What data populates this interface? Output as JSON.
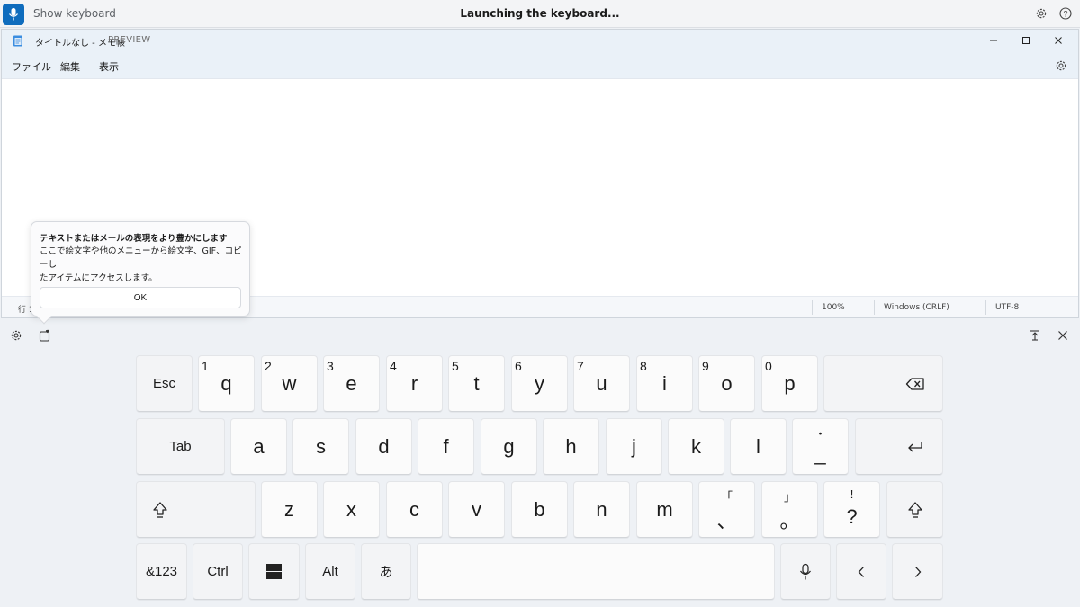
{
  "voice_bar": {
    "hint": "Show keyboard",
    "status": "Launching the keyboard...",
    "settings_icon": "gear-icon",
    "help_icon": "question-icon"
  },
  "notepad": {
    "title": "タイトルなし - メモ帳",
    "preview_badge": "PREVIEW",
    "menu": [
      "ファイル",
      "編集",
      "表示"
    ],
    "status": {
      "line": "行 1",
      "zoom": "100%",
      "line_ending": "Windows (CRLF)",
      "encoding": "UTF-8"
    }
  },
  "tooltip": {
    "title": "テキストまたはメールの表現をより豊かにします",
    "body_line1": "ここで絵文字や他のメニューから絵文字、GIF、コピーし",
    "body_line2": "たアイテムにアクセスします。",
    "ok_label": "OK"
  },
  "keyboard": {
    "row1": [
      {
        "num": "1",
        "label": "q"
      },
      {
        "num": "2",
        "label": "w"
      },
      {
        "num": "3",
        "label": "e"
      },
      {
        "num": "4",
        "label": "r"
      },
      {
        "num": "5",
        "label": "t"
      },
      {
        "num": "6",
        "label": "y"
      },
      {
        "num": "7",
        "label": "u"
      },
      {
        "num": "8",
        "label": "i"
      },
      {
        "num": "9",
        "label": "o"
      },
      {
        "num": "0",
        "label": "p"
      }
    ],
    "row2": [
      "a",
      "s",
      "d",
      "f",
      "g",
      "h",
      "j",
      "k",
      "l"
    ],
    "row2_extra": {
      "top": "・",
      "bottom": "_"
    },
    "row3": [
      "z",
      "x",
      "c",
      "v",
      "b",
      "n",
      "m"
    ],
    "row3_punct": [
      {
        "top": "「",
        "bottom": "、"
      },
      {
        "top": "」",
        "bottom": "。"
      },
      {
        "top": "!",
        "bottom": "?"
      }
    ],
    "esc": "Esc",
    "tab": "Tab",
    "sym": "&123",
    "ctrl": "Ctrl",
    "alt": "Alt",
    "ime": "あ"
  }
}
